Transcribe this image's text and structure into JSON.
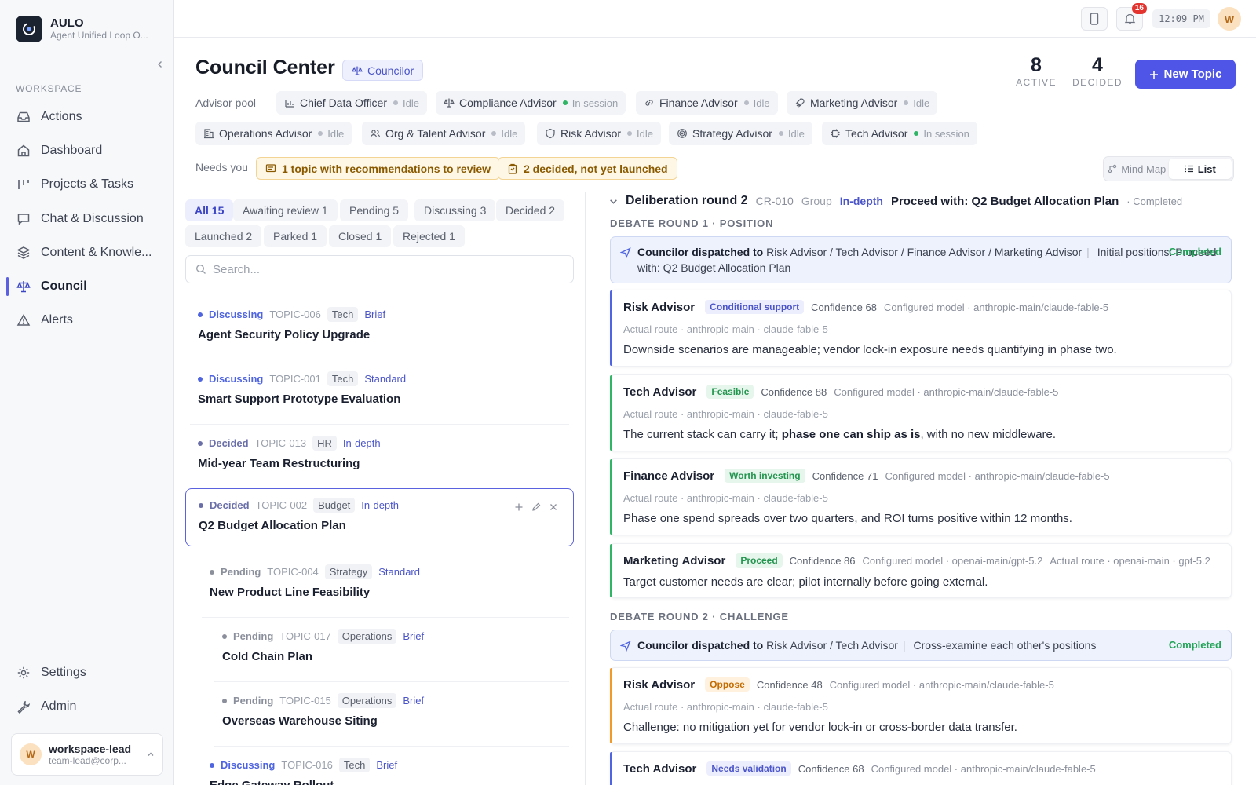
{
  "brand": {
    "name": "AULO",
    "subtitle": "Agent Unified Loop O..."
  },
  "sidebar": {
    "section": "WORKSPACE",
    "items": [
      {
        "label": "Actions",
        "icon": "inbox-icon"
      },
      {
        "label": "Dashboard",
        "icon": "home-icon"
      },
      {
        "label": "Projects & Tasks",
        "icon": "kanban-icon"
      },
      {
        "label": "Chat & Discussion",
        "icon": "chat-icon"
      },
      {
        "label": "Content & Knowle...",
        "icon": "layers-icon"
      },
      {
        "label": "Council",
        "icon": "scale-icon",
        "active": true
      },
      {
        "label": "Alerts",
        "icon": "warning-icon"
      }
    ],
    "bottom": [
      {
        "label": "Settings",
        "icon": "gear-icon"
      },
      {
        "label": "Admin",
        "icon": "wrench-icon"
      }
    ],
    "user": {
      "initial": "W",
      "name": "workspace-lead",
      "email": "team-lead@corp..."
    }
  },
  "topbar": {
    "notifications": "16",
    "time": "12:09 PM",
    "avatar": "W"
  },
  "header": {
    "title": "Council Center",
    "role": "Councilor",
    "stats": [
      {
        "value": "8",
        "label": "ACTIVE"
      },
      {
        "value": "4",
        "label": "DECIDED"
      }
    ],
    "new_topic": "New Topic",
    "pool_label": "Advisor pool",
    "advisors": [
      {
        "name": "Chief Data Officer",
        "status": "Idle",
        "active": false,
        "icon": "chart-icon"
      },
      {
        "name": "Compliance Advisor",
        "status": "In session",
        "active": true,
        "icon": "scale-icon"
      },
      {
        "name": "Finance Advisor",
        "status": "Idle",
        "active": false,
        "icon": "link-icon"
      },
      {
        "name": "Marketing Advisor",
        "status": "Idle",
        "active": false,
        "icon": "rocket-icon"
      },
      {
        "name": "Operations Advisor",
        "status": "Idle",
        "active": false,
        "icon": "building-icon"
      },
      {
        "name": "Org & Talent Advisor",
        "status": "Idle",
        "active": false,
        "icon": "people-icon"
      },
      {
        "name": "Risk Advisor",
        "status": "Idle",
        "active": false,
        "icon": "shield-icon"
      },
      {
        "name": "Strategy Advisor",
        "status": "Idle",
        "active": false,
        "icon": "target-icon"
      },
      {
        "name": "Tech Advisor",
        "status": "In session",
        "active": true,
        "icon": "chip-icon"
      }
    ],
    "needs_label": "Needs you",
    "needs": [
      {
        "label": "1 topic with recommendations to review",
        "icon": "message-icon"
      },
      {
        "label": "2 decided, not yet launched",
        "icon": "clipboard-icon"
      }
    ],
    "views": [
      {
        "label": "Mind Map",
        "active": false
      },
      {
        "label": "List",
        "active": true
      }
    ]
  },
  "filters": [
    {
      "label": "All 15",
      "active": true
    },
    {
      "label": "Awaiting review 1"
    },
    {
      "label": "Pending 5"
    },
    {
      "label": "Discussing 3"
    },
    {
      "label": "Decided 2"
    },
    {
      "label": "Launched 2"
    },
    {
      "label": "Parked 1"
    },
    {
      "label": "Closed 1"
    },
    {
      "label": "Rejected 1"
    }
  ],
  "search": {
    "placeholder": "Search..."
  },
  "topics": [
    {
      "status": "Discussing",
      "id": "TOPIC-006",
      "category": "Tech",
      "depth": "Brief",
      "title": "Agent Security Policy Upgrade",
      "color": "#4f64e0"
    },
    {
      "status": "Discussing",
      "id": "TOPIC-001",
      "category": "Tech",
      "depth": "Standard",
      "title": "Smart Support Prototype Evaluation",
      "color": "#4f64e0"
    },
    {
      "status": "Decided",
      "id": "TOPIC-013",
      "category": "HR",
      "depth": "In-depth",
      "title": "Mid-year Team Restructuring",
      "color": "#6b6fa8"
    },
    {
      "status": "Decided",
      "id": "TOPIC-002",
      "category": "Budget",
      "depth": "In-depth",
      "title": "Q2 Budget Allocation Plan",
      "color": "#6b6fa8",
      "selected": true
    },
    {
      "status": "Pending",
      "id": "TOPIC-004",
      "category": "Strategy",
      "depth": "Standard",
      "title": "New Product Line Feasibility",
      "color": "#8a8f9b"
    },
    {
      "status": "Pending",
      "id": "TOPIC-017",
      "category": "Operations",
      "depth": "Brief",
      "title": "Cold Chain Plan",
      "color": "#8a8f9b"
    },
    {
      "status": "Pending",
      "id": "TOPIC-015",
      "category": "Operations",
      "depth": "Brief",
      "title": "Overseas Warehouse Siting",
      "color": "#8a8f9b"
    },
    {
      "status": "Discussing",
      "id": "TOPIC-016",
      "category": "Tech",
      "depth": "Brief",
      "title": "Edge Gateway Rollout",
      "color": "#4f64e0"
    }
  ],
  "detail": {
    "round_title": "Deliberation round 2",
    "id": "CR-010",
    "group": "Group",
    "depth": "In-depth",
    "topic": "Proceed with: Q2 Budget Allocation Plan",
    "state": "· Completed",
    "round1": {
      "label": "DEBATE ROUND 1 · POSITION",
      "dispatch": {
        "prefix": "Councilor dispatched to",
        "targets": "Risk Advisor / Tech Advisor / Finance Advisor / Marketing Advisor",
        "note": "Initial positions: Proceed with: Q2 Budget Allocation Plan",
        "status": "Completed"
      },
      "opinions": [
        {
          "name": "Risk Advisor",
          "tag": "Conditional support",
          "tagColor": "blue",
          "confidence": "Confidence 68",
          "model": "Configured model · anthropic-main/claude-fable-5",
          "route": "Actual route · anthropic-main · claude-fable-5",
          "text": "Downside scenarios are manageable; vendor lock-in exposure needs quantifying in phase two."
        },
        {
          "name": "Tech Advisor",
          "tag": "Feasible",
          "tagColor": "green",
          "confidence": "Confidence 88",
          "model": "Configured model · anthropic-main/claude-fable-5",
          "route": "Actual route · anthropic-main · claude-fable-5",
          "text_a": "The current stack can carry it; ",
          "text_b": "phase one can ship as is",
          "text_c": ", with no new middleware."
        },
        {
          "name": "Finance Advisor",
          "tag": "Worth investing",
          "tagColor": "green",
          "confidence": "Confidence 71",
          "model": "Configured model · anthropic-main/claude-fable-5",
          "route": "Actual route · anthropic-main · claude-fable-5",
          "text": "Phase one spend spreads over two quarters, and ROI turns positive within 12 months."
        },
        {
          "name": "Marketing Advisor",
          "tag": "Proceed",
          "tagColor": "green",
          "confidence": "Confidence 86",
          "model": "Configured model · openai-main/gpt-5.2",
          "route": "Actual route · openai-main · gpt-5.2",
          "text": "Target customer needs are clear; pilot internally before going external."
        }
      ]
    },
    "round2": {
      "label": "DEBATE ROUND 2 · CHALLENGE",
      "dispatch": {
        "prefix": "Councilor dispatched to",
        "targets": "Risk Advisor / Tech Advisor",
        "note": "Cross-examine each other's positions",
        "status": "Completed"
      },
      "opinions": [
        {
          "name": "Risk Advisor",
          "tag": "Oppose",
          "tagColor": "orange",
          "confidence": "Confidence 48",
          "model": "Configured model · anthropic-main/claude-fable-5",
          "route": "Actual route · anthropic-main · claude-fable-5",
          "text": "Challenge: no mitigation yet for vendor lock-in or cross-border data transfer."
        },
        {
          "name": "Tech Advisor",
          "tag": "Needs validation",
          "tagColor": "blue",
          "confidence": "Confidence 68",
          "model": "Configured model · anthropic-main/claude-fable-5"
        }
      ]
    }
  },
  "colors": {
    "accent": "#4f55e6",
    "active_dot": "#2fb565",
    "completed": "#23a559"
  }
}
